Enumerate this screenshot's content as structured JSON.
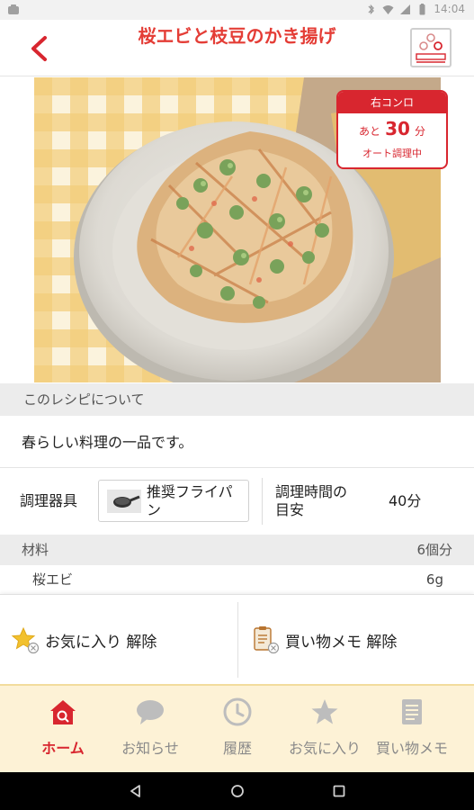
{
  "status_bar": {
    "time": "14:04"
  },
  "header": {
    "title": "桜エビと枝豆のかき揚げ"
  },
  "timer_badge": {
    "burner": "右コンロ",
    "prefix": "あと",
    "minutes": "30",
    "unit": "分",
    "status": "オート調理中"
  },
  "about": {
    "heading": "このレシピについて",
    "text": "春らしい料理の一品です。"
  },
  "tools": {
    "label": "調理器具",
    "tool_name": "推奨フライパン",
    "time_label": "調理時間の目安",
    "time_value": "40分"
  },
  "ingredients": {
    "heading": "材料",
    "servings": "6個分",
    "items": [
      {
        "name": "桜エビ",
        "amount": "6g"
      }
    ]
  },
  "actions": {
    "favorite_label": "お気に入り 解除",
    "memo_label": "買い物メモ 解除"
  },
  "tabs": [
    {
      "label": "ホーム",
      "icon": "home-icon",
      "active": true
    },
    {
      "label": "お知らせ",
      "icon": "speech-bubble-icon",
      "active": false
    },
    {
      "label": "履歴",
      "icon": "clock-icon",
      "active": false
    },
    {
      "label": "お気に入り",
      "icon": "star-icon",
      "active": false
    },
    {
      "label": "買い物メモ",
      "icon": "memo-icon",
      "active": false
    }
  ],
  "colors": {
    "accent_red": "#d8262f",
    "title_red": "#e43d36",
    "tab_bar_bg": "#fdf2d6",
    "tab_inactive": "#8a8a8a",
    "section_bg": "#ececec"
  }
}
